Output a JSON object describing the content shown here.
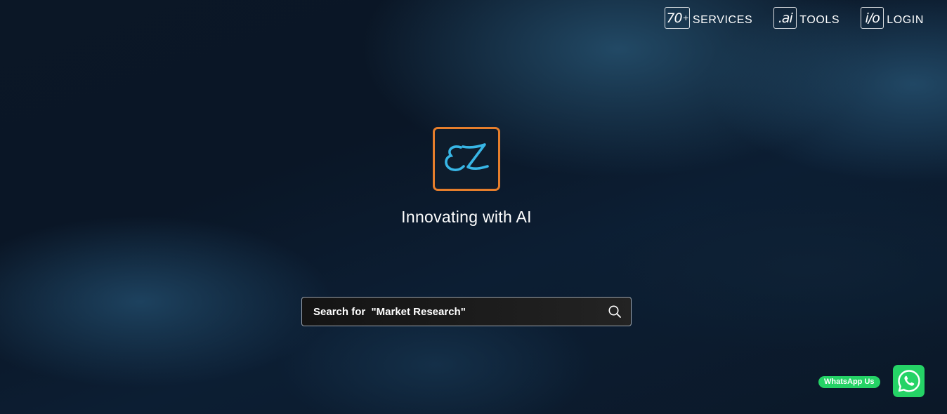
{
  "nav": {
    "items": [
      {
        "badge": "70",
        "badge_sup": "+",
        "label": "SERVICES"
      },
      {
        "badge": ".ai",
        "label": "TOOLS"
      },
      {
        "badge": "i/o",
        "label": "LOGIN"
      }
    ]
  },
  "logo": {
    "text": "EZ",
    "icon": "ez-logo",
    "border_color": "#e67e2c",
    "letter_color": "#38b6e6"
  },
  "hero": {
    "tagline": "Innovating with AI"
  },
  "search": {
    "placeholder": "Search for  \"Market Research\"",
    "icon": "search-icon"
  },
  "whatsapp": {
    "label": "WhatsApp Us",
    "icon": "whatsapp-icon",
    "color": "#25d366"
  }
}
